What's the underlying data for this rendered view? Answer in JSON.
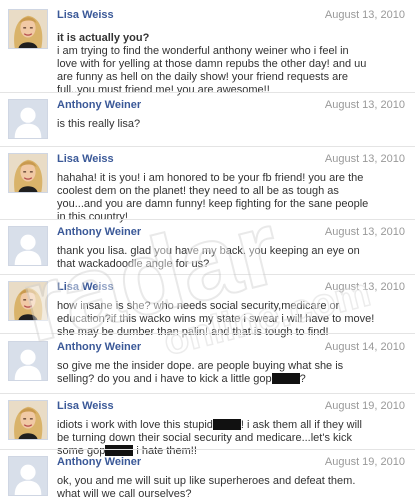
{
  "messages": [
    {
      "sender": "Lisa Weiss",
      "avatar": "lisa-weiss-photo",
      "date": "August 13, 2010",
      "lines": [
        "it is actually you?",
        "i am trying to find the wonderful anthony weiner who i feel in",
        "love with for yelling at those damn repubs the other day! and uu",
        "are funny as hell on the daily show! your friend requests are",
        "full..you must friend me! you are awesome!!"
      ]
    },
    {
      "sender": "Anthony Weiner",
      "avatar": "default-silhouette",
      "date": "August 13, 2010",
      "lines": [
        "is this really lisa?"
      ]
    },
    {
      "sender": "Lisa Weiss",
      "avatar": "lisa-weiss-photo",
      "date": "August 13, 2010",
      "lines": [
        "hahaha! it is you! i am honored to be your fb friend! you are the",
        "coolest dem on the planet! they need to all be as tough as",
        "you...and you are damn funny! keep fighting for the sane people",
        "in this country!"
      ]
    },
    {
      "sender": "Anthony Weiner",
      "avatar": "default-silhouette",
      "date": "August 13, 2010",
      "lines": [
        "thank you lisa. glad you have my back. you keeping an eye on",
        "that wackadoodle angle for us?"
      ]
    },
    {
      "sender": "Lisa Weiss",
      "avatar": "lisa-weiss-photo",
      "date": "August 13, 2010",
      "lines": [
        "how insane is she? who needs social security,medicare or",
        "education?if this wacko wins my state i swear i will have to move!",
        "she may be dumber than palin! and that is tough to find!"
      ]
    },
    {
      "sender": "Anthony Weiner",
      "avatar": "default-silhouette",
      "date": "August 14, 2010",
      "lines": [
        "so give me the insider dope. are people buying what she is",
        "selling? do you and i have to kick a little gop[REDACTED]?"
      ]
    },
    {
      "sender": "Lisa Weiss",
      "avatar": "lisa-weiss-photo",
      "date": "August 19, 2010",
      "lines": [
        "idiots i work with love this stupid[REDACTED]! i ask them all if they will",
        "be turning down their social security and medicare...let's kick",
        "some gop[REDACTED] i hate them!!"
      ]
    },
    {
      "sender": "Anthony Weiner",
      "avatar": "default-silhouette",
      "date": "August 19, 2010",
      "lines": [
        "ok, you and me will suit up like superheroes and defeat them.",
        "what will we call ourselves?"
      ]
    }
  ],
  "watermark": {
    "brand": "radar",
    "site": "online.com"
  },
  "colors": {
    "sender_link": "#3b5998",
    "date_text": "#999999",
    "body_text": "#333333",
    "divider": "#e4e4e4",
    "redaction": "#111111"
  }
}
